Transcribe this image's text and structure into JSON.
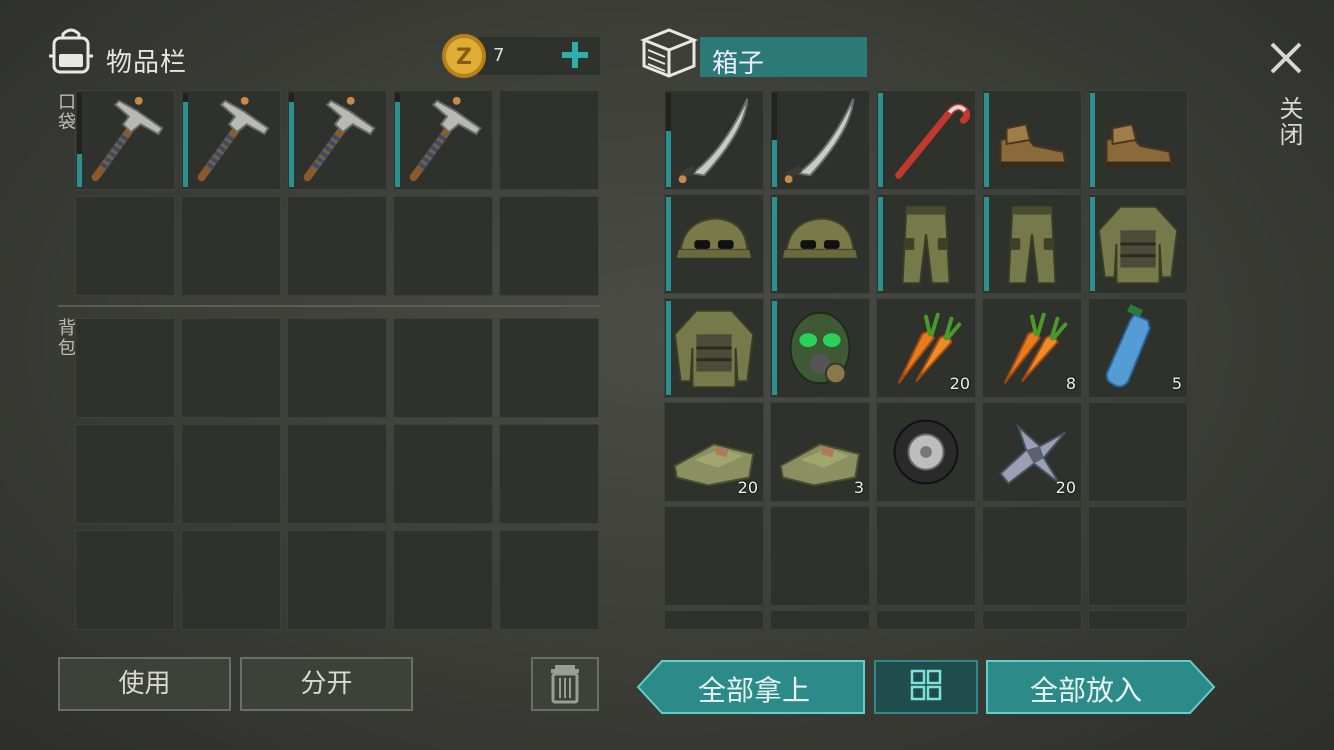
{
  "inventory": {
    "title": "物品栏",
    "coin_count": "7",
    "pocket_label": "口袋",
    "backpack_label": "背包",
    "pocket_items": [
      {
        "icon": "pickaxe-icon",
        "durability": 0.35
      },
      {
        "icon": "pickaxe-icon",
        "durability": 0.9
      },
      {
        "icon": "pickaxe-icon",
        "durability": 0.9
      },
      {
        "icon": "pickaxe-icon",
        "durability": 0.9
      }
    ]
  },
  "box": {
    "title": "箱子",
    "items": [
      {
        "icon": "machete-icon",
        "durability": 0.6,
        "count": ""
      },
      {
        "icon": "machete-icon",
        "durability": 0.5,
        "count": ""
      },
      {
        "icon": "crowbar-icon",
        "durability": 1.0,
        "count": ""
      },
      {
        "icon": "boots-icon",
        "durability": 1.0,
        "count": ""
      },
      {
        "icon": "boots-icon",
        "durability": 1.0,
        "count": ""
      },
      {
        "icon": "military-cap-icon",
        "durability": 1.0,
        "count": ""
      },
      {
        "icon": "military-cap-icon",
        "durability": 1.0,
        "count": ""
      },
      {
        "icon": "camo-pants-icon",
        "durability": 1.0,
        "count": ""
      },
      {
        "icon": "camo-pants-icon",
        "durability": 1.0,
        "count": ""
      },
      {
        "icon": "camo-jacket-icon",
        "durability": 1.0,
        "count": ""
      },
      {
        "icon": "camo-jacket-icon",
        "durability": 1.0,
        "count": ""
      },
      {
        "icon": "gas-mask-icon",
        "durability": 1.0,
        "count": ""
      },
      {
        "icon": "carrot-icon",
        "count": "20"
      },
      {
        "icon": "carrot-icon",
        "count": "8"
      },
      {
        "icon": "water-bottle-icon",
        "count": "5"
      },
      {
        "icon": "cloth-icon",
        "count": "20"
      },
      {
        "icon": "cloth-icon",
        "count": "3"
      },
      {
        "icon": "tire-icon",
        "count": ""
      },
      {
        "icon": "scrap-metal-icon",
        "count": "20"
      }
    ]
  },
  "close_label": "关闭",
  "buttons": {
    "use": "使用",
    "split": "分开",
    "take_all": "全部拿上",
    "put_all": "全部放入"
  },
  "colors": {
    "accent": "#2a9190",
    "coin": "#d9a22a"
  }
}
